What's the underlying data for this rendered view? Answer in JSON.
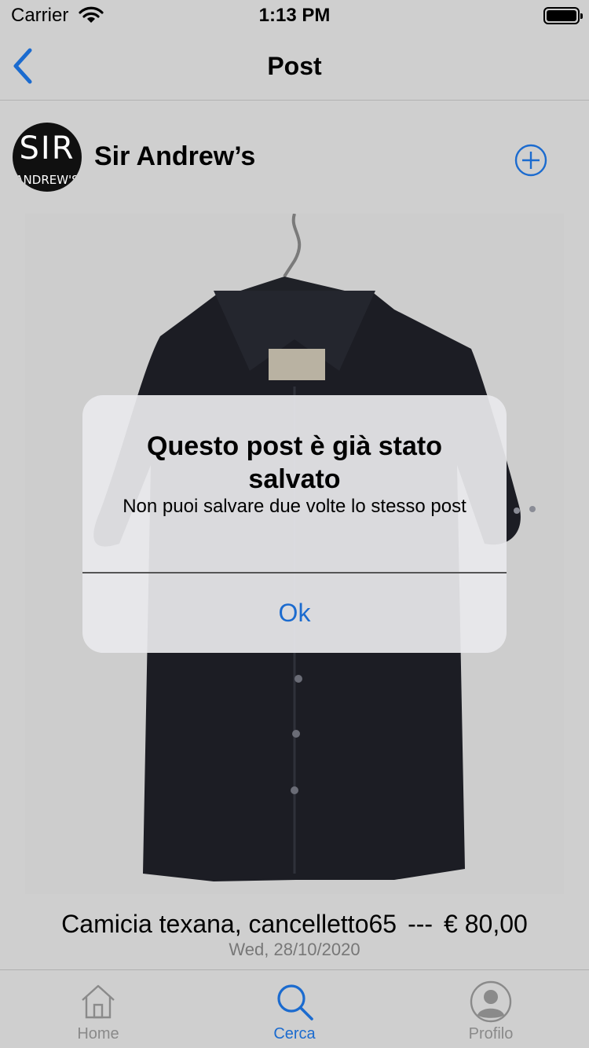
{
  "status_bar": {
    "carrier": "Carrier",
    "time": "1:13 PM"
  },
  "nav": {
    "title": "Post"
  },
  "post": {
    "account": {
      "name": "Sir Andrew’s",
      "avatar_text_big": "SIR",
      "avatar_text_small": "ANDREW'S"
    },
    "title": "Camicia texana, cancelletto65",
    "separator": "---",
    "price": "€ 80,00",
    "date": "Wed, 28/10/2020"
  },
  "alert": {
    "title": "Questo post è già stato salvato",
    "message": "Non puoi salvare due volte lo stesso post",
    "ok_label": "Ok"
  },
  "tabs": [
    {
      "label": "Home",
      "icon": "house-icon",
      "active": false
    },
    {
      "label": "Cerca",
      "icon": "search-icon",
      "active": true
    },
    {
      "label": "Profilo",
      "icon": "person-icon",
      "active": false
    }
  ],
  "colors": {
    "accent": "#1b6bcf",
    "background": "#cfcfcf",
    "inactive": "#8a8a8a"
  }
}
